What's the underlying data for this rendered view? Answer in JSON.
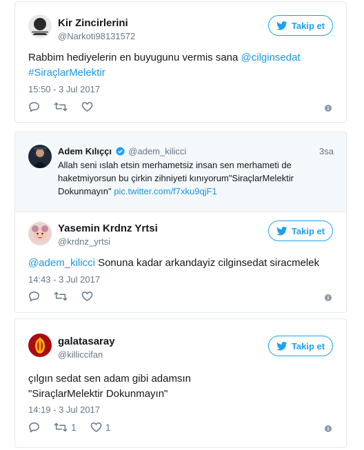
{
  "tweets": [
    {
      "name": "Kir Zincirlerini",
      "handle": "@Narkoti98131572",
      "follow_label": "Takip et",
      "text_plain": "Rabbim hediyelerin en buyugunu vermis sana ",
      "text_mention": "@cilginsedat",
      "text_hashtag": "#SiraçlarMelektir",
      "timestamp": "15:50 - 3 Jul 2017"
    },
    {
      "quote": {
        "name": "Adem Kılıççı",
        "handle": "@adem_kilicci",
        "time": "3sa",
        "text": "Allah seni ıslah etsin merhametsiz insan sen merhameti de haketmiyorsun bu çirkin zihniyeti kınıyorum\"SiraçlarMelektir Dokunmayın\" ",
        "link": "pic.twitter.com/f7xku9qjF1"
      },
      "name": "Yasemin Krdnz Yrtsi",
      "handle": "@krdnz_yrtsi",
      "follow_label": "Takip et",
      "text_mention": "@adem_kilicci",
      "text_plain": " Sonuna kadar arkandayiz cilginsedat siracmelek",
      "timestamp": "14:43 - 3 Jul 2017"
    },
    {
      "name": "galatasaray",
      "handle": "@killiccifan",
      "follow_label": "Takip et",
      "text_line1": "çılgın sedat sen adam gibi adamsın",
      "text_line2": "\"SiraçlarMelektir Dokunmayın\"",
      "timestamp": "14:19 - 3 Jul 2017",
      "retweet_count": "1",
      "like_count": "1"
    }
  ],
  "colors": {
    "accent": "#1da1f2",
    "link": "#1b95e0",
    "muted": "#657786",
    "border": "#e1e8ed",
    "quote_bg": "#f5f8fa"
  },
  "icons": [
    "twitter-bird-icon",
    "reply-icon",
    "retweet-icon",
    "like-icon",
    "info-icon",
    "verified-badge-icon"
  ]
}
